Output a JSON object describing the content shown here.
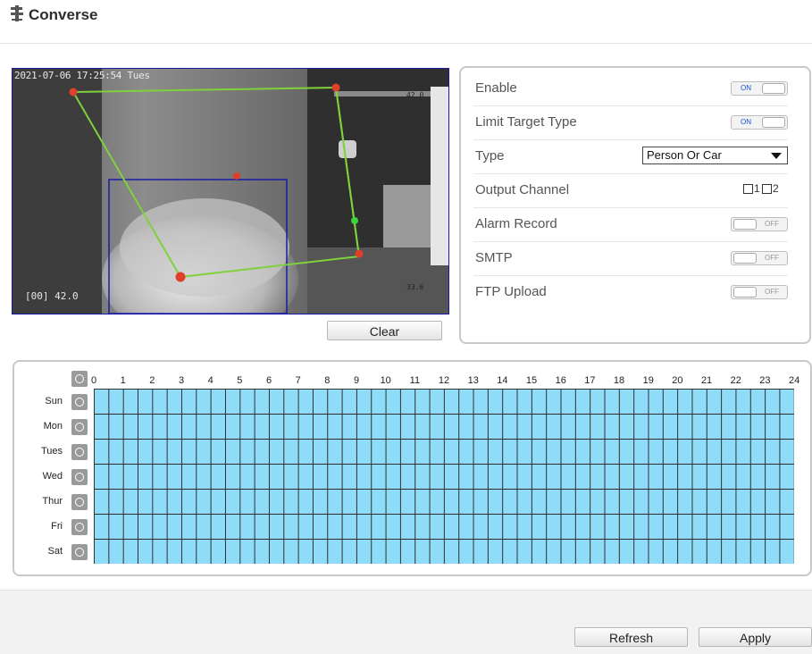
{
  "header": {
    "title": "Converse",
    "icon": "converse-icon"
  },
  "video": {
    "osd_timestamp": "2021-07-06 17:25:54 Tues",
    "osd_channel": "[00] 42.0",
    "temp_top": "42.0",
    "temp_bottom": "33.6",
    "clear_label": "Clear"
  },
  "settings": {
    "enable": {
      "label": "Enable",
      "state": "ON"
    },
    "limit_target_type": {
      "label": "Limit Target Type",
      "state": "ON"
    },
    "type": {
      "label": "Type",
      "value": "Person Or Car"
    },
    "output_channel": {
      "label": "Output Channel",
      "channels": [
        "1",
        "2"
      ]
    },
    "alarm_record": {
      "label": "Alarm Record",
      "state": "OFF"
    },
    "smtp": {
      "label": "SMTP",
      "state": "OFF"
    },
    "ftp_upload": {
      "label": "FTP Upload",
      "state": "OFF"
    }
  },
  "schedule": {
    "hours": [
      "0",
      "1",
      "2",
      "3",
      "4",
      "5",
      "6",
      "7",
      "8",
      "9",
      "10",
      "11",
      "12",
      "13",
      "14",
      "15",
      "16",
      "17",
      "18",
      "19",
      "20",
      "21",
      "22",
      "23",
      "24"
    ],
    "days": [
      "Sun",
      "Mon",
      "Tues",
      "Wed",
      "Thur",
      "Fri",
      "Sat"
    ],
    "fill_color": "#8fdcf8"
  },
  "footer": {
    "refresh_label": "Refresh",
    "apply_label": "Apply"
  }
}
